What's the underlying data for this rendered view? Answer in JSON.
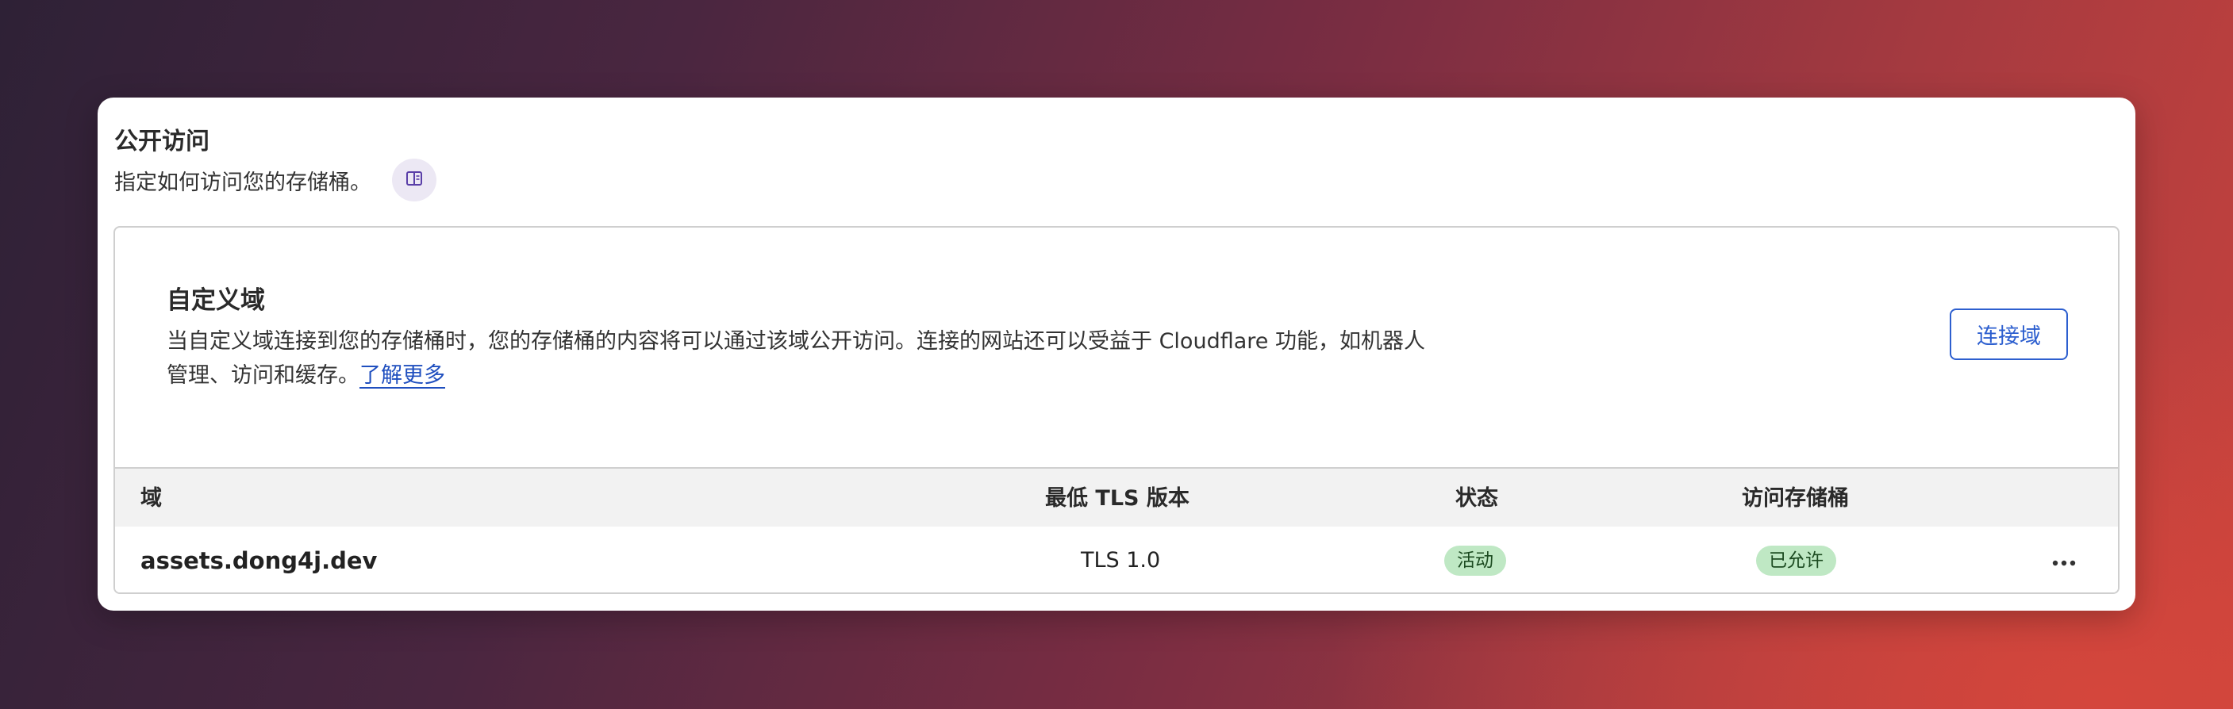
{
  "card": {
    "title": "公开访问",
    "subtitle": "指定如何访问您的存储桶。",
    "doc_icon": "book-open-icon"
  },
  "custom_domain": {
    "title": "自定义域",
    "description": "当自定义域连接到您的存储桶时，您的存储桶的内容将可以通过该域公开访问。连接的网站还可以受益于 Cloudflare 功能，如机器人管理、访问和缓存。",
    "learn_more": "了解更多",
    "connect_button": "连接域"
  },
  "table": {
    "headers": {
      "domain": "域",
      "min_tls": "最低 TLS 版本",
      "status": "状态",
      "bucket_access": "访问存储桶"
    },
    "rows": [
      {
        "domain": "assets.dong4j.dev",
        "min_tls": "TLS 1.0",
        "status": "活动",
        "bucket_access": "已允许",
        "actions_icon": "more-horizontal-icon"
      }
    ]
  },
  "colors": {
    "link": "#1f4fbf",
    "button": "#2d5fcf",
    "badge_bg": "#bfe8c4",
    "badge_text": "#1c4b21"
  }
}
